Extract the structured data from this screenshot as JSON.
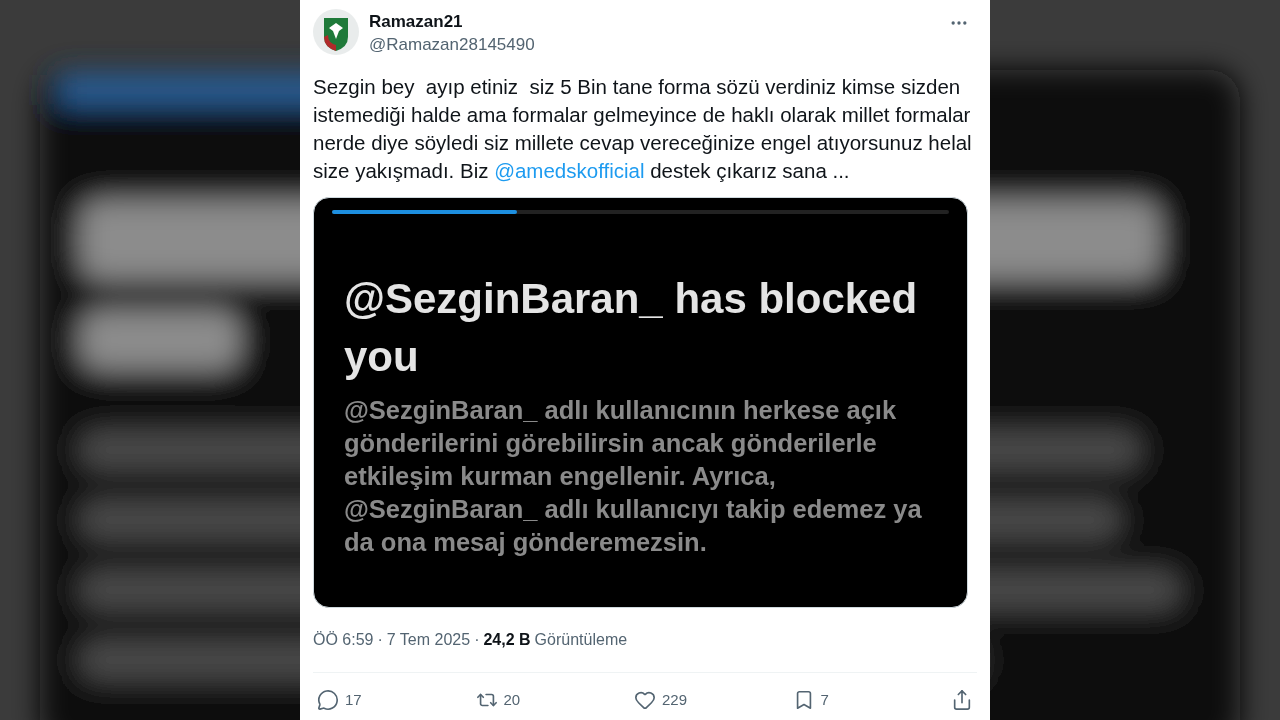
{
  "tweet": {
    "display_name": "Ramazan21",
    "handle": "@Ramazan28145490",
    "text": "Sezgin bey  ayıp etiniz  siz 5 Bin tane forma sözü verdiniz kimse sizden istemediği halde ama formalar gelmeyince de haklı olarak millet formalar nerde diye söyledi siz millete cevap vereceğinize engel atıyorsunuz helal size yakışmadı. Biz ",
    "mention": "@amedskofficial",
    "text_end": " destek çıkarız sana ...",
    "embedded_screenshot": {
      "progress": {
        "level": 0.3
      },
      "heading": "@SezginBaran_ has blocked you",
      "body": "@SezginBaran_ adlı kullanıcının herkese açık gönderilerini görebilirsin ancak gönderilerle etkileşim kurman engellenir. Ayrıca, @SezginBaran_ adlı kullanıcıyı takip edemez ya da ona mesaj gönderemezsin."
    },
    "separator": "·",
    "time": "ÖÖ 6:59",
    "date": "7 Tem 2025",
    "views": "24,2 B",
    "views_label": "Görüntüleme",
    "actions": [
      {
        "kind": "reply",
        "count": "17"
      },
      {
        "kind": "repost",
        "count": "20"
      },
      {
        "kind": "like",
        "count": "229"
      },
      {
        "kind": "bookmark",
        "count": "7"
      },
      {
        "kind": "share"
      }
    ]
  }
}
